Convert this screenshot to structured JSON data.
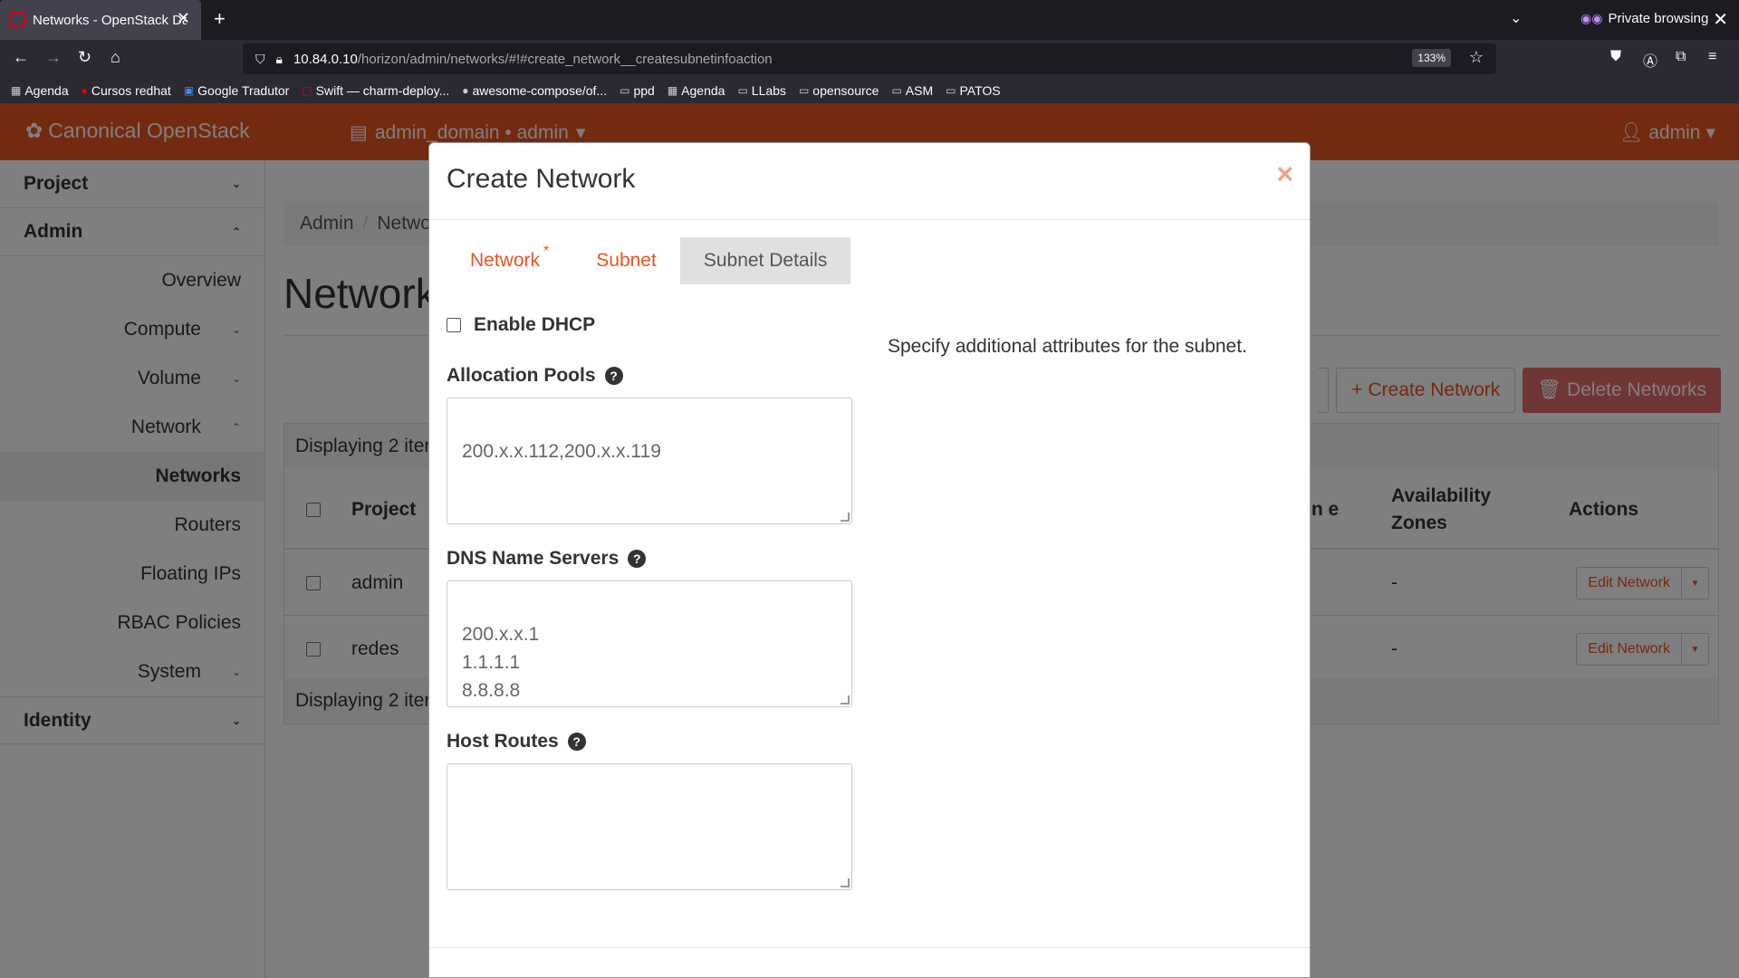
{
  "browser": {
    "tab_title": "Networks - OpenStack Da",
    "new_tab": "+",
    "private_label": "Private browsing",
    "url_host": "10.84.0.10",
    "url_path": "/horizon/admin/networks/#!#create_network__createsubnetinfoaction",
    "zoom": "133%",
    "bookmarks": [
      {
        "label": "Agenda",
        "icon": "calendar-icon"
      },
      {
        "label": "Cursos redhat",
        "icon": "redhat-icon"
      },
      {
        "label": "Google Tradutor",
        "icon": "translate-icon"
      },
      {
        "label": "Swift — charm-deploy...",
        "icon": "swift-icon"
      },
      {
        "label": "awesome-compose/of...",
        "icon": "github-icon"
      },
      {
        "label": "ppd",
        "icon": "folder-icon"
      },
      {
        "label": "Agenda",
        "icon": "calendar-icon"
      },
      {
        "label": "LLabs",
        "icon": "folder-icon"
      },
      {
        "label": "opensource",
        "icon": "folder-icon"
      },
      {
        "label": "ASM",
        "icon": "folder-icon"
      },
      {
        "label": "PATOS",
        "icon": "folder-icon"
      }
    ]
  },
  "header": {
    "logo": "Canonical OpenStack",
    "project": "admin_domain • admin",
    "user": "admin",
    "accent": "#e95420"
  },
  "sidebar": {
    "project": "Project",
    "admin": "Admin",
    "overview": "Overview",
    "compute": "Compute",
    "volume": "Volume",
    "network": "Network",
    "networks": "Networks",
    "routers": "Routers",
    "floating_ips": "Floating IPs",
    "rbac": "RBAC Policies",
    "system": "System",
    "identity": "Identity"
  },
  "main": {
    "breadcrumb_admin": "Admin",
    "breadcrumb_sep": "/",
    "breadcrumb_networks": "Netwo",
    "title": "Network",
    "create_button": "Create Network",
    "delete_button": "Delete Networks",
    "displaying": "Displaying 2 iter",
    "col_project": "Project",
    "col_admin_state": "in e",
    "col_az": "Availability Zones",
    "col_actions": "Actions",
    "rows": [
      {
        "project": "admin",
        "az": "-",
        "action": "Edit Network"
      },
      {
        "project": "redes",
        "az": "-",
        "action": "Edit Network"
      }
    ],
    "footer": "Displaying 2 iter"
  },
  "modal": {
    "title": "Create Network",
    "close": "×",
    "tabs": [
      {
        "label": "Network",
        "required": "*"
      },
      {
        "label": "Subnet"
      },
      {
        "label": "Subnet Details"
      }
    ],
    "dhcp_label": "Enable DHCP",
    "dhcp_checked": false,
    "allocation_label": "Allocation Pools",
    "allocation_value": "200.x.x.112,200.x.x.119",
    "dns_label": "DNS Name Servers",
    "dns_value": "200.x.x.1\n1.1.1.1\n8.8.8.8",
    "routes_label": "Host Routes",
    "routes_value": "",
    "help_text": "Specify additional attributes for the subnet."
  }
}
